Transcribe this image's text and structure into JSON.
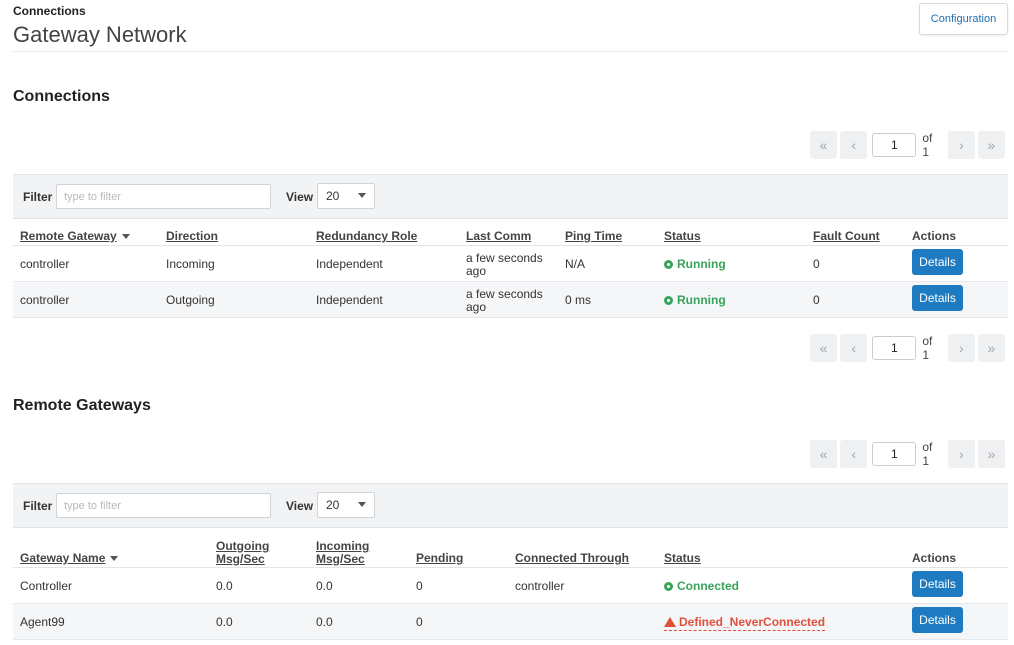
{
  "header": {
    "breadcrumb": "Connections",
    "title": "Gateway Network",
    "config_button": "Configuration"
  },
  "pager": {
    "first": "«",
    "prev": "‹",
    "page": "1",
    "of": "of 1",
    "next": "›",
    "last": "»"
  },
  "connections": {
    "title": "Connections",
    "filter_label": "Filter",
    "filter_placeholder": "type to filter",
    "view_label": "View",
    "view_value": "20",
    "columns": [
      "Remote Gateway",
      "Direction",
      "Redundancy Role",
      "Last Comm",
      "Ping Time",
      "Status",
      "Fault Count",
      "Actions"
    ],
    "rows": [
      {
        "remote_gateway": "controller",
        "direction": "Incoming",
        "role": "Independent",
        "last_comm_1": "a few seconds",
        "last_comm_2": "ago",
        "ping": "N/A",
        "status": "Running",
        "faults": "0",
        "action": "Details"
      },
      {
        "remote_gateway": "controller",
        "direction": "Outgoing",
        "role": "Independent",
        "last_comm_1": "a few seconds",
        "last_comm_2": "ago",
        "ping": "0 ms",
        "status": "Running",
        "faults": "0",
        "action": "Details"
      }
    ]
  },
  "remote_gateways": {
    "title": "Remote Gateways",
    "filter_label": "Filter",
    "filter_placeholder": "type to filter",
    "view_label": "View",
    "view_value": "20",
    "columns": [
      "Gateway Name",
      "Outgoing",
      "Msg/Sec",
      "Incoming",
      "Msg/Sec",
      "Pending",
      "Connected Through",
      "Status",
      "Actions"
    ],
    "rows": [
      {
        "name": "Controller",
        "outgoing": "0.0",
        "incoming": "0.0",
        "pending": "0",
        "through": "controller",
        "status": "Connected",
        "action": "Details"
      },
      {
        "name": "Agent99",
        "outgoing": "0.0",
        "incoming": "0.0",
        "pending": "0",
        "through": "",
        "status": "Defined_NeverConnected",
        "action": "Details"
      }
    ]
  },
  "colors": {
    "accent": "#1f7bc1",
    "ok": "#3aa35b",
    "error": "#e0503c"
  },
  "icons": {
    "status_ok": "running-status-icon",
    "status_warning": "warning-triangle-icon",
    "sort": "sort-caret-icon",
    "select": "chevron-down-icon"
  }
}
